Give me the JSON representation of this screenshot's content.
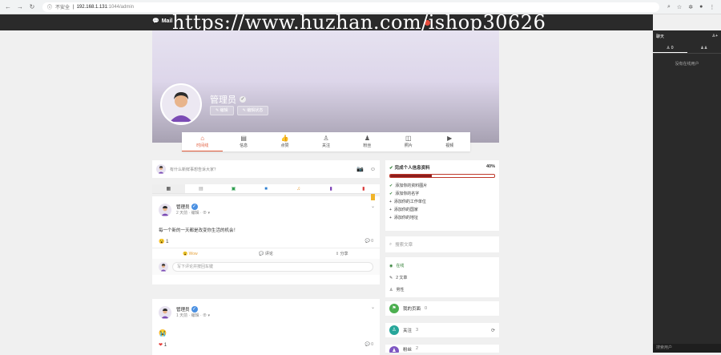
{
  "browser": {
    "security": "不安全",
    "host": "192.168.1.131",
    "path": ":1044/admin"
  },
  "topbar": {
    "brand": "Mail",
    "watermark": "https://www.huzhan.com/ishop30626"
  },
  "profile": {
    "name": "管理员",
    "edit_label": "编辑",
    "edit_state_label": "编辑状态"
  },
  "tabs": [
    {
      "label": "时间线",
      "icon": "⌂"
    },
    {
      "label": "信息",
      "icon": "▤"
    },
    {
      "label": "点赞",
      "icon": "👍"
    },
    {
      "label": "关注",
      "icon": "♙"
    },
    {
      "label": "粉丝",
      "icon": "♟"
    },
    {
      "label": "照片",
      "icon": "◫"
    },
    {
      "label": "视频",
      "icon": "▶"
    }
  ],
  "composer": {
    "placeholder": "有什么新鲜事想告诉大家？"
  },
  "post1": {
    "author": "管理员",
    "meta": "2 天前 · 编辑 · ⊕ ▾",
    "text": "每一个新的一天都是改变你生活的机会！",
    "reaction_emoji": "😮",
    "reaction_count": "1",
    "comment_count": "0",
    "actions": {
      "wow": "Wow",
      "comment": "评论",
      "share": "分享"
    },
    "comment_placeholder": "写下评论并按回车键"
  },
  "post2": {
    "author": "管理员",
    "meta": "1 天前 · 编辑 · ⊕ ▾",
    "emoji": "😭",
    "reaction_emoji": "❤",
    "reaction_count": "1",
    "comment_count": "0"
  },
  "profile_card": {
    "title": "完成个人信息资料",
    "percent": "40%",
    "progress": 0.4,
    "items": [
      {
        "done": true,
        "label": "添加你的资料图片"
      },
      {
        "done": true,
        "label": "添加你的名字"
      },
      {
        "done": false,
        "label": "添加你的工作单位"
      },
      {
        "done": false,
        "label": "添加你的国家"
      },
      {
        "done": false,
        "label": "添加你的地址"
      }
    ]
  },
  "search": {
    "placeholder": "搜索文章"
  },
  "info": {
    "online": "在线",
    "posts": "2 文章",
    "gender": "男性"
  },
  "pages_row": {
    "label": "我的页面",
    "count": "0"
  },
  "follow_row": {
    "label": "关注",
    "count": "3"
  },
  "fans_row": {
    "label": "粉丝",
    "count": "2"
  },
  "chat": {
    "title": "聊天",
    "tab_count": "0",
    "empty": "没有在线用户",
    "search": "搜索用户"
  }
}
